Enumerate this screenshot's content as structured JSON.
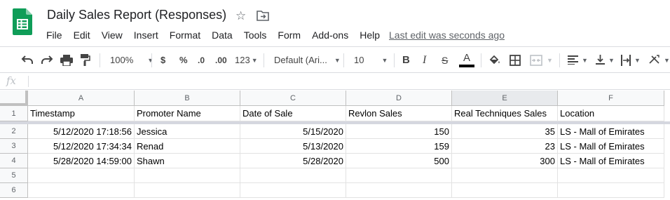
{
  "app": {
    "doc_title": "Daily Sales Report (Responses)",
    "last_edit": "Last edit was seconds ago",
    "brand_color": "#0f9d58"
  },
  "menu": [
    "File",
    "Edit",
    "View",
    "Insert",
    "Format",
    "Data",
    "Tools",
    "Form",
    "Add-ons",
    "Help"
  ],
  "toolbar": {
    "zoom": "100%",
    "currency": "$",
    "percent": "%",
    "decrease_decimal": ".0",
    "increase_decimal": ".00",
    "more_formats": "123",
    "font": "Default (Ari...",
    "font_size": "10",
    "bold": "B",
    "italic": "I",
    "strike": "S",
    "text_color_label": "A",
    "icons": [
      "undo-icon",
      "redo-icon",
      "print-icon",
      "paint-format-icon",
      "fill-color-icon",
      "borders-icon",
      "merge-icon",
      "align-left-icon",
      "valign-bottom-icon",
      "text-wrap-icon",
      "text-rotate-icon"
    ]
  },
  "formula_bar": {
    "fx_label": "fx",
    "value": ""
  },
  "grid": {
    "columns": [
      "A",
      "B",
      "C",
      "D",
      "E",
      "F"
    ],
    "row_numbers": [
      "1",
      "2",
      "3",
      "4",
      "5",
      "6"
    ],
    "header": [
      "Timestamp",
      "Promoter Name",
      "Date of Sale",
      "Revlon Sales",
      "Real Techniques Sales",
      "Location"
    ],
    "rows": [
      [
        "5/12/2020 17:18:56",
        "Jessica",
        "5/15/2020",
        "150",
        "35",
        "LS - Mall of Emirates"
      ],
      [
        "5/12/2020 17:34:34",
        "Renad",
        "5/13/2020",
        "159",
        "23",
        "LS - Mall of Emirates"
      ],
      [
        "5/28/2020 14:59:00",
        "Shawn",
        "5/28/2020",
        "500",
        "300",
        "LS - Mall of Emirates"
      ],
      [
        "",
        "",
        "",
        "",
        "",
        ""
      ],
      [
        "",
        "",
        "",
        "",
        "",
        ""
      ]
    ]
  }
}
